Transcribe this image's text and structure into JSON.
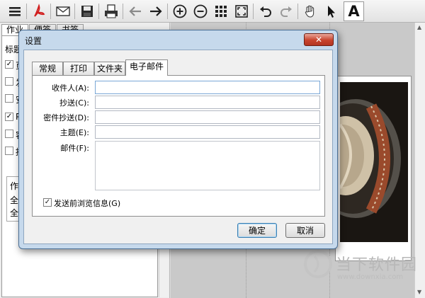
{
  "toolbar": {
    "icons": [
      "menu-icon",
      "pdf-icon",
      "email-icon",
      "save-icon",
      "print-icon",
      "back-arrow-icon",
      "forward-arrow-icon",
      "zoom-in-icon",
      "zoom-out-icon",
      "thumbnails-icon",
      "fit-page-icon",
      "undo-icon",
      "redo-icon",
      "hand-icon",
      "select-arrow-icon",
      "text-select-icon"
    ],
    "text_tool_label": "A"
  },
  "left_panel": {
    "tabs": [
      {
        "label": "作业"
      },
      {
        "label": "便签"
      },
      {
        "label": "书签"
      }
    ],
    "title_prefix": "标题",
    "rows": [
      {
        "checked": true,
        "mark": "✓",
        "label": "页"
      },
      {
        "checked": false,
        "mark": "",
        "label": "发"
      },
      {
        "checked": false,
        "mark": "",
        "label": "安"
      },
      {
        "checked": true,
        "mark": "✓",
        "label": "P"
      },
      {
        "checked": false,
        "mark": "",
        "label": "容"
      },
      {
        "checked": false,
        "mark": "",
        "label": "描"
      }
    ],
    "list_header": "作",
    "list_items": [
      "全",
      "全"
    ]
  },
  "watermark": {
    "text": "当下软件园",
    "url": "www.downxia.com"
  },
  "dialog": {
    "title": "设置",
    "close_label": "✕",
    "tabs": [
      {
        "label": "常规",
        "selected": false
      },
      {
        "label": "打印",
        "selected": false
      },
      {
        "label": "文件夹",
        "selected": false
      },
      {
        "label": "电子邮件",
        "selected": true
      }
    ],
    "fields": {
      "to": {
        "label": "收件人(A):",
        "value": ""
      },
      "cc": {
        "label": "抄送(C):",
        "value": ""
      },
      "bcc": {
        "label": "密件抄送(D):",
        "value": ""
      },
      "subject": {
        "label": "主题(E):",
        "value": ""
      },
      "body": {
        "label": "邮件(F):",
        "value": ""
      }
    },
    "preview_checkbox": {
      "label": "发送前浏览信息(G)",
      "checked": true,
      "mark": "✓"
    },
    "ok_label": "确定",
    "cancel_label": "取消"
  },
  "colors": {
    "dialog_frame": "#c6d9ec",
    "close_button": "#c8432d",
    "default_button_border": "#3c7fb1"
  }
}
